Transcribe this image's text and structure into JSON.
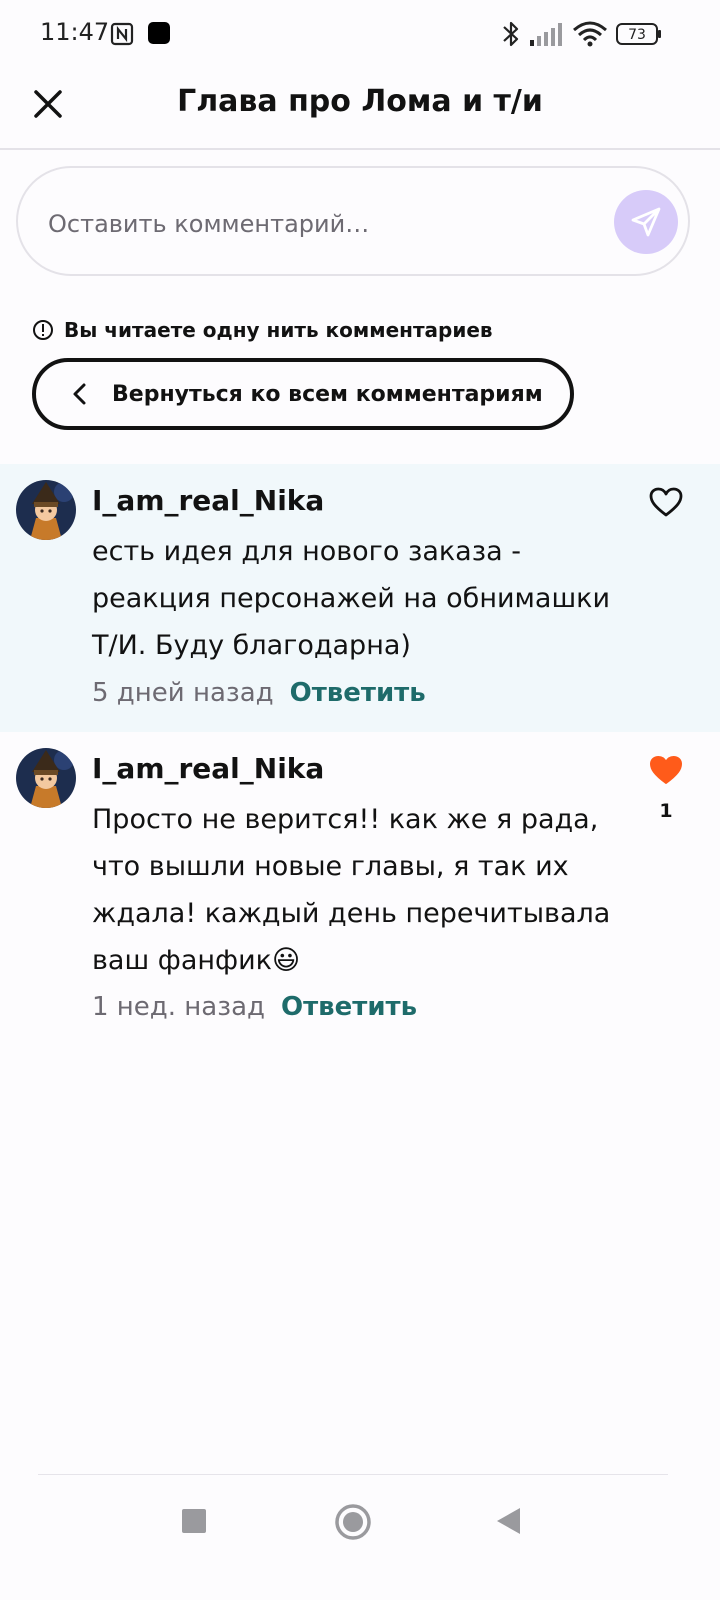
{
  "status_bar": {
    "time": "11:47",
    "battery": "73",
    "icons": [
      "nfc-icon",
      "notification-icon",
      "bluetooth-icon",
      "signal-icon",
      "wifi-icon",
      "battery-icon"
    ]
  },
  "header": {
    "title": "Глава про Лома и т/и",
    "close_icon": "close-icon"
  },
  "comment_input": {
    "placeholder": "Оставить комментарий…",
    "send_icon": "send-icon",
    "send_color": "#d7cbf9"
  },
  "thread": {
    "notice": "Вы читаете одну нить комментариев",
    "back_label": "Вернуться ко всем комментариям"
  },
  "comments": [
    {
      "author": "I_am_real_Nika",
      "lines": [
        "есть идея для нового заказа -",
        "реакция персонажей на обнимашки",
        "Т/И. Буду благодарна)"
      ],
      "time": "5 дней назад",
      "reply": "Ответить",
      "liked": false,
      "likes": ""
    },
    {
      "author": "I_am_real_Nika",
      "lines": [
        "Просто не верится!! как же я рада,",
        "что вышли новые главы, я так их",
        "ждала! каждый день перечитывала",
        "ваш фанфик😃"
      ],
      "time": "1 нед. назад",
      "reply": "Ответить",
      "liked": true,
      "likes": "1"
    }
  ],
  "colors": {
    "accent_teal": "#1e6b6a",
    "heart_liked": "#ff5b1a",
    "highlight_bg": "#f1f8fb"
  }
}
